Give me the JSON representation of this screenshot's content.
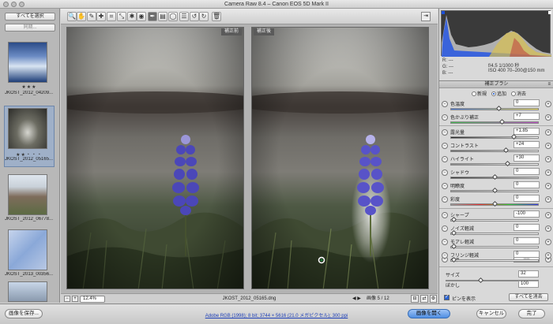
{
  "window": {
    "title": "Camera Raw 8.4  –  Canon EOS 5D Mark II"
  },
  "filmstrip": {
    "select_all_label": "すべてを選択",
    "sync_label": "同期...",
    "thumbs": [
      {
        "name": "JKOST_2012_04209...",
        "stars": "★★★"
      },
      {
        "name": "JKOST_2012_05165...",
        "stars": "★★・・・"
      },
      {
        "name": "JKOST_2012_06778...",
        "stars": ""
      },
      {
        "name": "JKOST_2013_00356...",
        "stars": ""
      },
      {
        "name": "",
        "stars": ""
      }
    ]
  },
  "toolbar": {
    "icons": [
      "zoom-icon",
      "hand-icon",
      "white-balance-icon",
      "color-sampler-icon",
      "crop-icon",
      "straighten-icon",
      "spot-removal-icon",
      "red-eye-icon",
      "adjustment-brush-icon",
      "graduated-filter-icon",
      "radial-filter-icon",
      "preferences-icon",
      "rotate-left-icon",
      "rotate-right-icon",
      "trash-icon"
    ],
    "glyphs": [
      "🔍",
      "✋",
      "✎",
      "✚",
      "⌗",
      "⤡",
      "✱",
      "◉",
      "✒",
      "▤",
      "◯",
      "☰",
      "↺",
      "↻",
      "🗑"
    ],
    "active_index": 8
  },
  "preview": {
    "before_label": "補正前",
    "after_label": "補正後"
  },
  "image_bottom": {
    "zoom": "12.4%",
    "filename": "JKOST_2012_05165.dng",
    "image_counter": "画像 5 / 12",
    "nav_arrows": "◀ ▶"
  },
  "info": {
    "r": "R:",
    "g": "G:",
    "b": "B:",
    "rgb_dash": "---",
    "aperture_shutter": "f/4.5   1/1000 秒",
    "iso_lens": "ISO 400   70–200@150 mm"
  },
  "panel": {
    "title": "補正ブラシ",
    "modes": [
      "新規",
      "追加",
      "消去"
    ],
    "active_mode": 1
  },
  "controls": [
    {
      "label": "色温度",
      "value": "0",
      "pos": 0.55
    },
    {
      "label": "色かぶり補正",
      "value": "+7",
      "pos": 0.58
    },
    {
      "label": "露光量",
      "value": "+1.85",
      "pos": 0.72
    },
    {
      "label": "コントラスト",
      "value": "+24",
      "pos": 0.63
    },
    {
      "label": "ハイライト",
      "value": "+30",
      "pos": 0.65
    },
    {
      "label": "シャドウ",
      "value": "0",
      "pos": 0.5
    },
    {
      "label": "明瞭度",
      "value": "0",
      "pos": 0.5
    },
    {
      "label": "彩度",
      "value": "0",
      "pos": 0.5
    },
    {
      "label": "シャープ",
      "value": "-100",
      "pos": 0.02
    },
    {
      "label": "ノイズ軽減",
      "value": "0",
      "pos": 0.02
    },
    {
      "label": "モアレ軽減",
      "value": "0",
      "pos": 0.02
    },
    {
      "label": "フリンジ軽減",
      "value": "0",
      "pos": 0.02
    }
  ],
  "color_label": "カラー",
  "brush": {
    "size_label": "サイズ",
    "size_value": "32",
    "feather_label": "ぼかし",
    "feather_value": "100"
  },
  "show_pins_label": "ピンを表示",
  "clear_all_label": "すべてを消去",
  "footer": {
    "save_label": "画像を保存...",
    "workflow_link": "Adobe RGB (1998); 8 bit; 3744 × 5616 (21.0 メガピクセル); 300 ppi",
    "open_label": "画像を開く",
    "cancel_label": "キャンセル",
    "done_label": "完了"
  },
  "colors": {
    "accent": "#4f8ee2",
    "link": "#1d3fb8",
    "flower": "#4b47b8"
  }
}
